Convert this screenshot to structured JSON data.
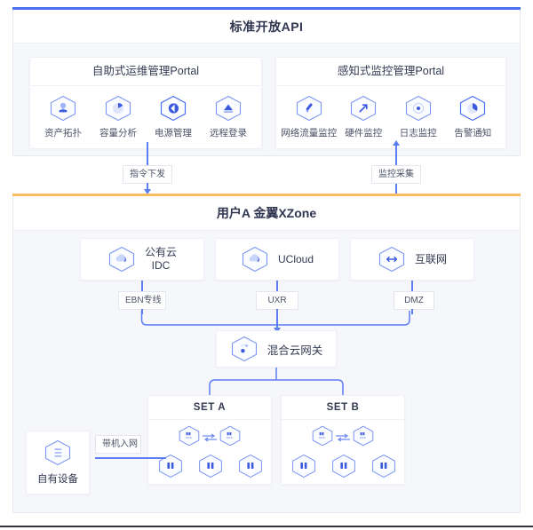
{
  "api_panel": {
    "title": "标准开放API",
    "accent_color": "#4a6ef0",
    "portals": [
      {
        "title": "自助式运维管理Portal",
        "functions": [
          {
            "label": "资产拓扑",
            "icon": "asset-topology-icon"
          },
          {
            "label": "容量分析",
            "icon": "capacity-analysis-icon"
          },
          {
            "label": "电源管理",
            "icon": "power-management-icon"
          },
          {
            "label": "远程登录",
            "icon": "remote-login-icon"
          }
        ]
      },
      {
        "title": "感知式监控管理Portal",
        "functions": [
          {
            "label": "网络流量监控",
            "icon": "network-traffic-icon"
          },
          {
            "label": "硬件监控",
            "icon": "hardware-monitor-icon"
          },
          {
            "label": "日志监控",
            "icon": "log-monitor-icon"
          },
          {
            "label": "告警通知",
            "icon": "alarm-notify-icon"
          }
        ]
      }
    ]
  },
  "connectors": {
    "command_label": "指令下发",
    "monitor_label": "监控采集",
    "line_color": "#5b7cf3"
  },
  "zone_panel": {
    "title": "用户A 金翼XZone",
    "accent_color": "#f7bd63",
    "clouds": [
      {
        "label_line1": "公有云",
        "label_line2": "IDC",
        "icon": "cloud-icon",
        "link_label": "EBN专线"
      },
      {
        "label_line1": "UCloud",
        "label_line2": "",
        "icon": "cloud-icon",
        "link_label": "UXR"
      },
      {
        "label_line1": "互联网",
        "label_line2": "",
        "icon": "internet-icon",
        "link_label": "DMZ"
      }
    ],
    "gateway": {
      "label": "混合云网关",
      "icon": "hybrid-cloud-gateway-icon"
    },
    "sets": [
      {
        "title": "SET A",
        "switches": [
          {
            "icon": "switch-icon"
          },
          {
            "icon": "switch-icon"
          }
        ],
        "servers": [
          {
            "icon": "server-icon"
          },
          {
            "icon": "server-icon"
          },
          {
            "icon": "server-icon"
          }
        ]
      },
      {
        "title": "SET B",
        "switches": [
          {
            "icon": "switch-icon"
          },
          {
            "icon": "switch-icon"
          }
        ],
        "servers": [
          {
            "icon": "server-icon"
          },
          {
            "icon": "server-icon"
          },
          {
            "icon": "server-icon"
          }
        ]
      }
    ],
    "own_device": {
      "label": "自有设备",
      "icon": "own-device-icon",
      "link_label": "带机入网"
    }
  }
}
